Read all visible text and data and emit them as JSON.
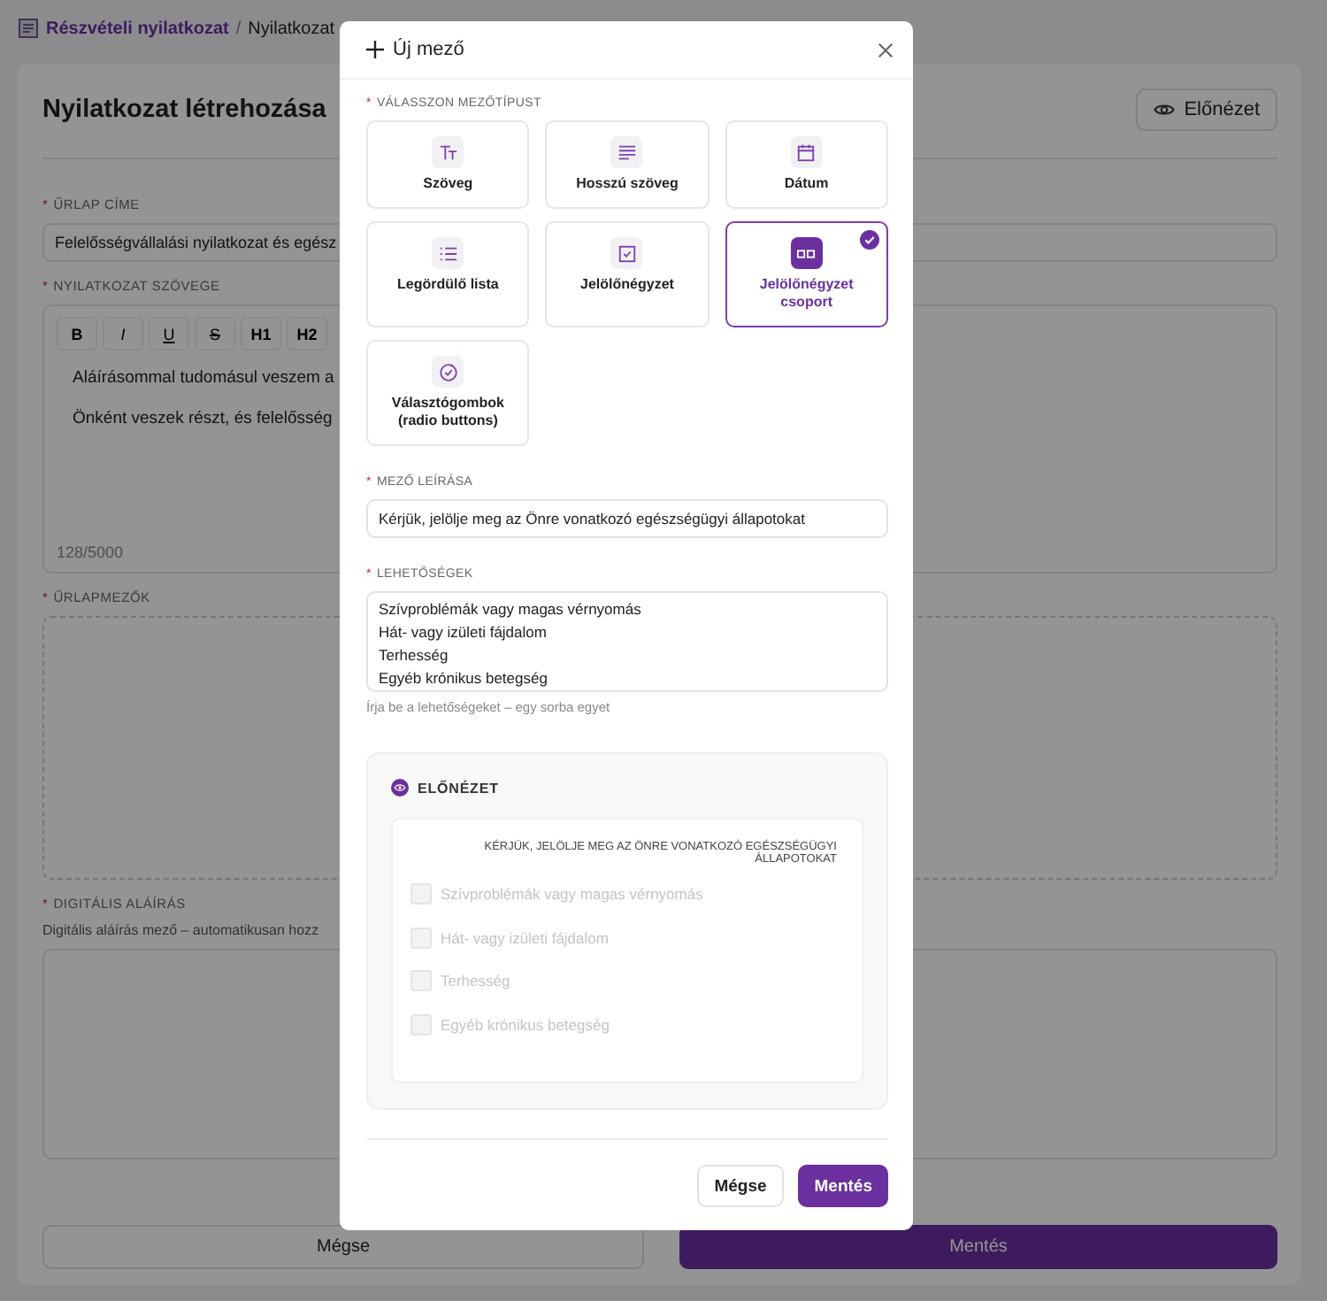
{
  "breadcrumb": {
    "items": [
      {
        "label": "Részvételi nyilatkozat"
      },
      {
        "label": "Nyilatkozat"
      }
    ],
    "separator": "/"
  },
  "required_mark": "*",
  "page": {
    "title": "Nyilatkozat létrehozása",
    "preview_button": "Előnézet",
    "form_title": {
      "label": "ŰRLAP CÍME",
      "value": "Felelősségvállalási nyilatkozat és egész"
    },
    "statement": {
      "label": "NYILATKOZAT SZÖVEGE",
      "toolbar": [
        {
          "label": "B",
          "kind": "bold"
        },
        {
          "label": "I",
          "kind": "italic"
        },
        {
          "label": "U",
          "kind": "underline"
        },
        {
          "label": "S",
          "kind": "strike"
        },
        {
          "label": "H1",
          "kind": "heading"
        },
        {
          "label": "H2",
          "kind": "heading"
        }
      ],
      "paragraphs": [
        "Aláírásommal tudomásul veszem a",
        "Önként veszek részt, és felelősség"
      ],
      "counter": "128/5000"
    },
    "form_fields": {
      "label": "ŰRLAPMEZŐK"
    },
    "signature": {
      "label": "DIGITÁLIS ALÁÍRÁS",
      "description": "Digitális aláírás mező – automatikusan hozz"
    },
    "buttons": {
      "cancel": "Mégse",
      "save": "Mentés"
    }
  },
  "modal": {
    "title": "Új mező",
    "type_label": "VÁLASSZON MEZŐTÍPUST",
    "types": [
      {
        "label": "Szöveg",
        "selected": false
      },
      {
        "label": "Hosszú szöveg",
        "selected": false
      },
      {
        "label": "Dátum",
        "selected": false
      },
      {
        "label": "Legördülő lista",
        "selected": false
      },
      {
        "label": "Jelölőnégyzet",
        "selected": false
      },
      {
        "label": "Jelölőnégyzet csoport",
        "selected": true
      },
      {
        "label": "Választógombok (radio buttons)",
        "selected": false
      }
    ],
    "description": {
      "label": "MEZŐ LEÍRÁSA",
      "value": "Kérjük, jelölje meg az Önre vonatkozó egészségügyi állapotokat"
    },
    "options": {
      "label": "LEHETŐSÉGEK",
      "lines": [
        "Szívproblémák vagy magas vérnyomás",
        "Hát- vagy izületi fájdalom",
        "Terhesség",
        "Egyéb krónikus betegség"
      ],
      "hint": "Írja be a lehetőségeket – egy sorba egyet"
    },
    "preview": {
      "title": "ELŐNÉZET",
      "question": "KÉRJÜK, JELÖLJE MEG AZ ÖNRE VONATKOZÓ EGÉSZSÉGÜGYI ÁLLAPOTOKAT",
      "options": [
        {
          "label": "Szívproblémák vagy magas vérnyomás",
          "checked": false
        },
        {
          "label": "Hát- vagy izületi fájdalom",
          "checked": false
        },
        {
          "label": "Terhesség",
          "checked": false
        },
        {
          "label": "Egyéb krónikus betegség",
          "checked": false
        }
      ]
    },
    "buttons": {
      "cancel": "Mégse",
      "save": "Mentés"
    }
  }
}
